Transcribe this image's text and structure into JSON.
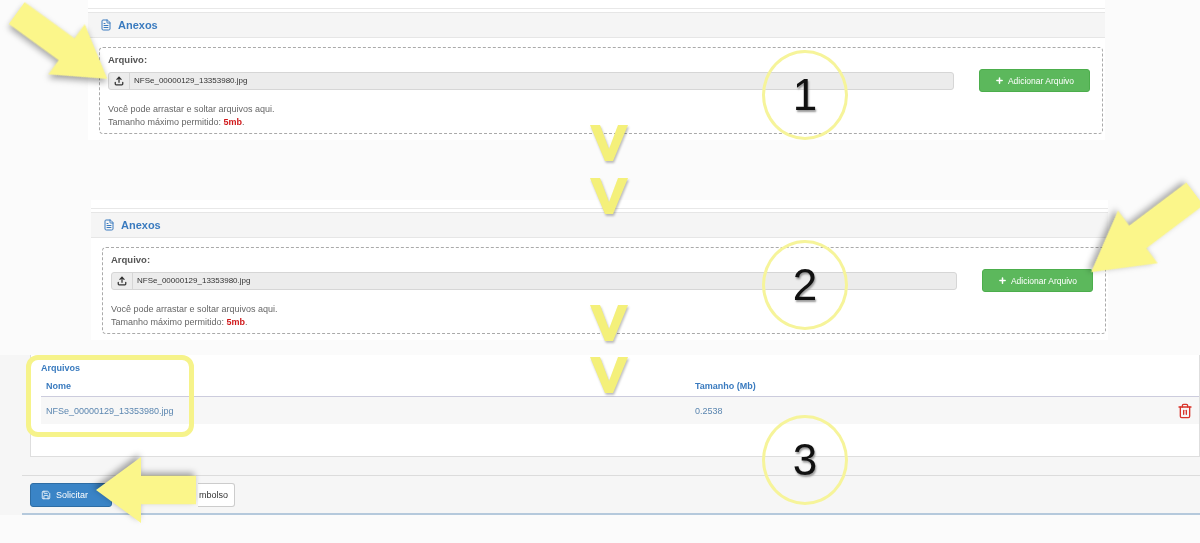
{
  "upload_panels": [
    {
      "title": "Anexos",
      "field_label": "Arquivo:",
      "file_name": "NFSe_00000129_13353980.jpg",
      "button": "Adicionar Arquivo",
      "hint": "Você pode arrastar e soltar arquivos aqui.",
      "limit": "Tamanho máximo permitido: **5mb**."
    },
    {
      "title": "Anexos",
      "field_label": "Arquivo:",
      "file_name": "NFSe_00000129_13353980.jpg",
      "button": "Adicionar Arquivo",
      "hint": "Você pode arrastar e soltar arquivos aqui.",
      "limit": "Tamanho máximo permitido: **5mb**."
    }
  ],
  "files_panel": {
    "title": "Arquivos",
    "columns": [
      "Nome",
      "Tamanho (Mb)"
    ],
    "rows": [
      {
        "name": "NFSe_00000129_13353980.jpg",
        "size": "0.2538"
      }
    ],
    "buttons": [
      {
        "label": "Solicitar",
        "kind": "primary"
      },
      {
        "label": "mbolso",
        "kind": "default"
      }
    ]
  },
  "steps": [
    {
      "number": "1"
    },
    {
      "number": "2"
    },
    {
      "number": "3"
    }
  ]
}
